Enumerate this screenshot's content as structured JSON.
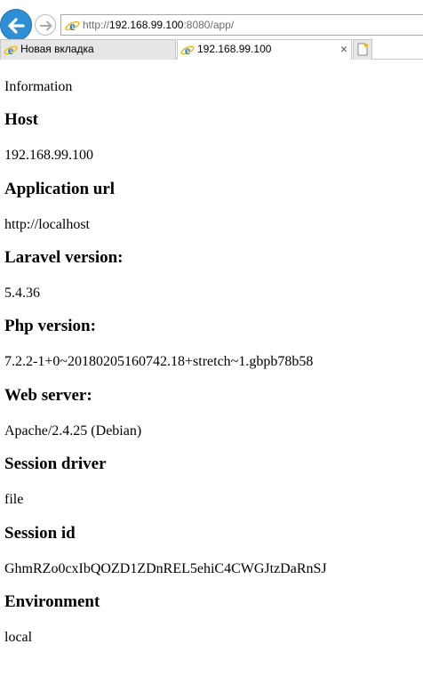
{
  "browser": {
    "url": {
      "prefix": "http://",
      "host": "192.168.99.100",
      "suffix": ":8080/app/"
    },
    "tabs": [
      {
        "label": "Новая вкладка",
        "active": false
      },
      {
        "label": "192.168.99.100",
        "active": true,
        "close_glyph": "×"
      }
    ],
    "icons": {
      "back": "back-arrow-icon",
      "forward": "forward-arrow-icon",
      "page": "ie-page-icon",
      "new_tab": "new-tab-icon"
    },
    "colors": {
      "back_button": "#2f8fd6",
      "ie_blue": "#1e7fd1",
      "ie_ring": "#f2b600"
    }
  },
  "page": {
    "title": "Information",
    "fields": [
      {
        "label": "Host",
        "value": "192.168.99.100"
      },
      {
        "label": "Application url",
        "value": "http://localhost"
      },
      {
        "label": "Laravel version:",
        "value": "5.4.36"
      },
      {
        "label": "Php version:",
        "value": "7.2.2-1+0~20180205160742.18+stretch~1.gbpb78b58"
      },
      {
        "label": "Web server:",
        "value": "Apache/2.4.25 (Debian)"
      },
      {
        "label": "Session driver",
        "value": "file"
      },
      {
        "label": "Session id",
        "value": "GhmRZo0cxIbQOZD1ZDnREL5ehiC4CWGJtzDaRnSJ"
      },
      {
        "label": "Environment",
        "value": "local"
      }
    ]
  }
}
